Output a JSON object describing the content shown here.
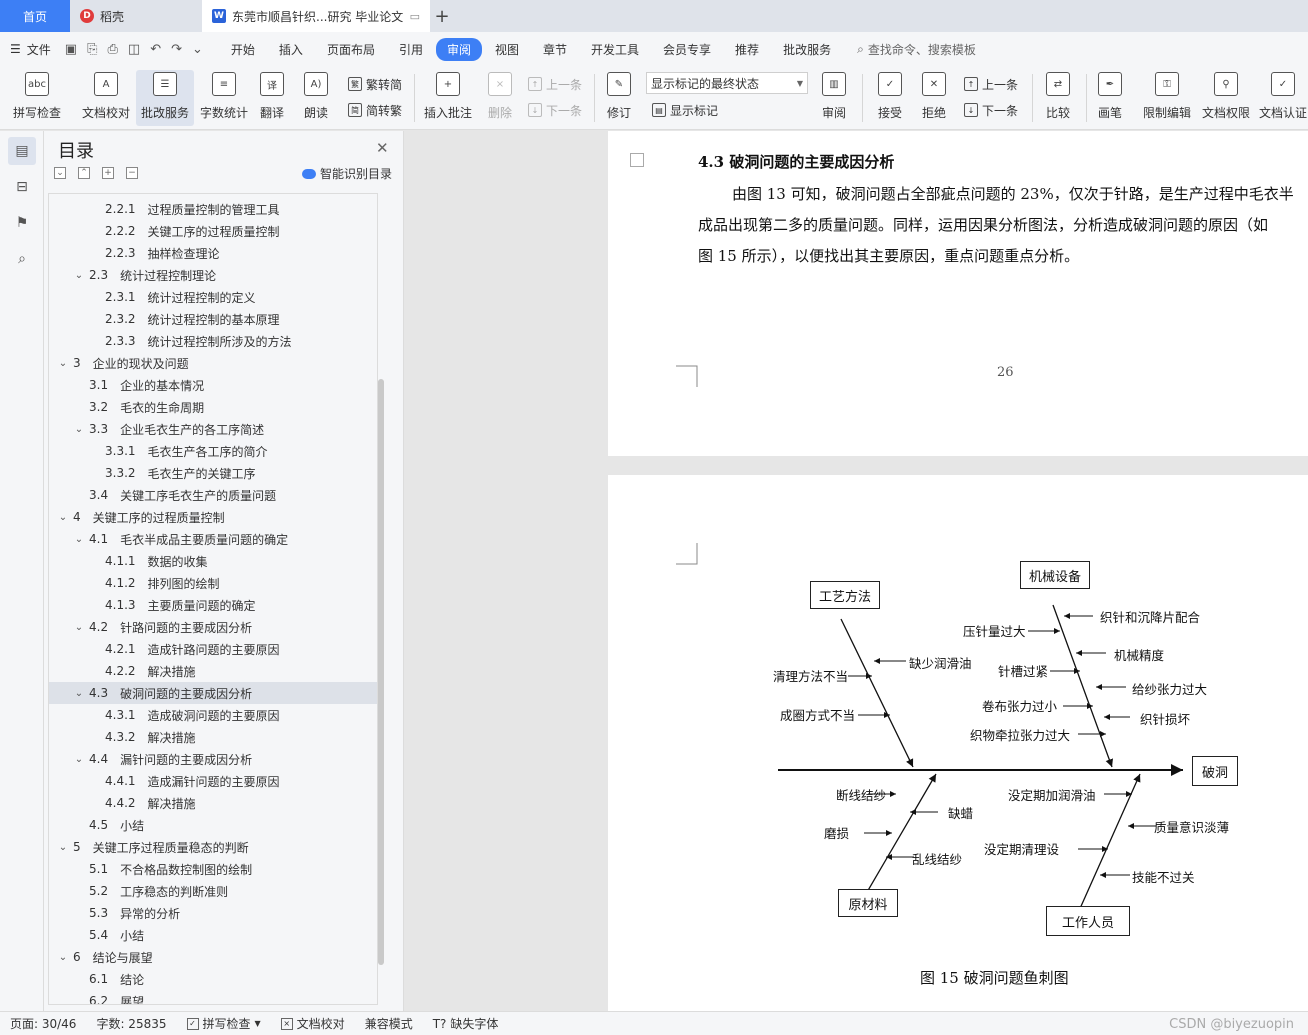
{
  "tabs": {
    "home": "首页",
    "daoke": "稻壳",
    "doc": "东莞市顺昌针织...研究 毕业论文"
  },
  "menu": {
    "file": "文件",
    "items": [
      "开始",
      "插入",
      "页面布局",
      "引用",
      "审阅",
      "视图",
      "章节",
      "开发工具",
      "会员专享",
      "推荐",
      "批改服务"
    ],
    "active": "审阅",
    "search": "查找命令、搜索模板"
  },
  "ribbon": {
    "spell": "拼写检查",
    "proof": "文档校对",
    "review_service": "批改服务",
    "wordcount": "字数统计",
    "translate": "翻译",
    "read": "朗读",
    "to_trad": "繁转简",
    "to_simp": "简转繁",
    "insert_comment": "插入批注",
    "delete": "删除",
    "prev": "上一条",
    "next": "下一条",
    "revise": "修订",
    "markup_state": "显示标记的最终状态",
    "show_markup": "显示标记",
    "reviewing": "审阅",
    "accept": "接受",
    "reject": "拒绝",
    "prev2": "上一条",
    "next2": "下一条",
    "compare": "比较",
    "ink": "画笔",
    "restrict": "限制编辑",
    "perm": "文档权限",
    "cert": "文档认证"
  },
  "toc": {
    "title": "目录",
    "smart": "智能识别目录",
    "items": [
      {
        "num": "2.2.1",
        "text": "过程质量控制的管理工具",
        "level": 3,
        "arrow": ""
      },
      {
        "num": "2.2.2",
        "text": "关键工序的过程质量控制",
        "level": 3,
        "arrow": ""
      },
      {
        "num": "2.2.3",
        "text": "抽样检查理论",
        "level": 3,
        "arrow": ""
      },
      {
        "num": "2.3",
        "text": "统计过程控制理论",
        "level": 2,
        "arrow": "v"
      },
      {
        "num": "2.3.1",
        "text": "统计过程控制的定义",
        "level": 3,
        "arrow": ""
      },
      {
        "num": "2.3.2",
        "text": "统计过程控制的基本原理",
        "level": 3,
        "arrow": ""
      },
      {
        "num": "2.3.3",
        "text": "统计过程控制所涉及的方法",
        "level": 3,
        "arrow": ""
      },
      {
        "num": "3",
        "text": "企业的现状及问题",
        "level": 1,
        "arrow": "v"
      },
      {
        "num": "3.1",
        "text": "企业的基本情况",
        "level": 2,
        "arrow": ""
      },
      {
        "num": "3.2",
        "text": "毛衣的生命周期",
        "level": 2,
        "arrow": ""
      },
      {
        "num": "3.3",
        "text": "企业毛衣生产的各工序简述",
        "level": 2,
        "arrow": "v"
      },
      {
        "num": "3.3.1",
        "text": "毛衣生产各工序的简介",
        "level": 3,
        "arrow": ""
      },
      {
        "num": "3.3.2",
        "text": "毛衣生产的关键工序",
        "level": 3,
        "arrow": ""
      },
      {
        "num": "3.4",
        "text": "关键工序毛衣生产的质量问题",
        "level": 2,
        "arrow": ""
      },
      {
        "num": "4",
        "text": "关键工序的过程质量控制",
        "level": 1,
        "arrow": "v"
      },
      {
        "num": "4.1",
        "text": "毛衣半成品主要质量问题的确定",
        "level": 2,
        "arrow": "v"
      },
      {
        "num": "4.1.1",
        "text": "数据的收集",
        "level": 3,
        "arrow": ""
      },
      {
        "num": "4.1.2",
        "text": "排列图的绘制",
        "level": 3,
        "arrow": ""
      },
      {
        "num": "4.1.3",
        "text": "主要质量问题的确定",
        "level": 3,
        "arrow": ""
      },
      {
        "num": "4.2",
        "text": "针路问题的主要成因分析",
        "level": 2,
        "arrow": "v"
      },
      {
        "num": "4.2.1",
        "text": "造成针路问题的主要原因",
        "level": 3,
        "arrow": ""
      },
      {
        "num": "4.2.2",
        "text": "解决措施",
        "level": 3,
        "arrow": ""
      },
      {
        "num": "4.3",
        "text": "破洞问题的主要成因分析",
        "level": 2,
        "arrow": "v",
        "selected": true
      },
      {
        "num": "4.3.1",
        "text": "造成破洞问题的主要原因",
        "level": 3,
        "arrow": ""
      },
      {
        "num": "4.3.2",
        "text": "解决措施",
        "level": 3,
        "arrow": ""
      },
      {
        "num": "4.4",
        "text": "漏针问题的主要成因分析",
        "level": 2,
        "arrow": "v"
      },
      {
        "num": "4.4.1",
        "text": "造成漏针问题的主要原因",
        "level": 3,
        "arrow": ""
      },
      {
        "num": "4.4.2",
        "text": "解决措施",
        "level": 3,
        "arrow": ""
      },
      {
        "num": "4.5",
        "text": "小结",
        "level": 2,
        "arrow": ""
      },
      {
        "num": "5",
        "text": "关键工序过程质量稳态的判断",
        "level": 1,
        "arrow": "v"
      },
      {
        "num": "5.1",
        "text": "不合格品数控制图的绘制",
        "level": 2,
        "arrow": ""
      },
      {
        "num": "5.2",
        "text": "工序稳态的判断准则",
        "level": 2,
        "arrow": ""
      },
      {
        "num": "5.3",
        "text": "异常的分析",
        "level": 2,
        "arrow": ""
      },
      {
        "num": "5.4",
        "text": "小结",
        "level": 2,
        "arrow": ""
      },
      {
        "num": "6",
        "text": "结论与展望",
        "level": 1,
        "arrow": "v"
      },
      {
        "num": "6.1",
        "text": "结论",
        "level": 2,
        "arrow": ""
      },
      {
        "num": "6.2",
        "text": "展望",
        "level": 2,
        "arrow": ""
      }
    ]
  },
  "doc": {
    "heading": "4.3    破洞问题的主要成因分析",
    "para_lines": [
      "由图 13 可知，破洞问题占全部疵点问题的 23%，仅次于针路，是生产过程中毛衣半",
      "成品出现第二多的质量问题。同样，运用因果分析图法，分析造成破洞问题的原因（如",
      "图 15 所示），以便找出其主要原因，重点问题重点分析。"
    ],
    "page_number": "26",
    "caption": "图 15    破洞问题鱼刺图"
  },
  "fishbone": {
    "effect": "破洞",
    "cat_process": "工艺方法",
    "cat_machine": "机械设备",
    "cat_material": "原材料",
    "cat_people": "工作人员",
    "process_causes": [
      "缺少润滑油",
      "清理方法不当",
      "成圈方式不当"
    ],
    "machine_causes": [
      "织针和沉降片配合",
      "压针量过大",
      "机械精度",
      "针槽过紧",
      "给纱张力过大",
      "卷布张力过小",
      "织针损坏",
      "织物牵拉张力过大"
    ],
    "material_causes": [
      "断线结纱",
      "缺蜡",
      "磨损",
      "乱线结纱"
    ],
    "people_causes": [
      "没定期加润滑油",
      "质量意识淡薄",
      "没定期清理设",
      "技能不过关"
    ]
  },
  "status": {
    "page": "页面: 30/46",
    "words": "字数: 25835",
    "spell": "拼写检查",
    "proof": "文档校对",
    "compat": "兼容模式",
    "missing_font": "缺失字体",
    "watermark": "CSDN @biyezuopin"
  }
}
